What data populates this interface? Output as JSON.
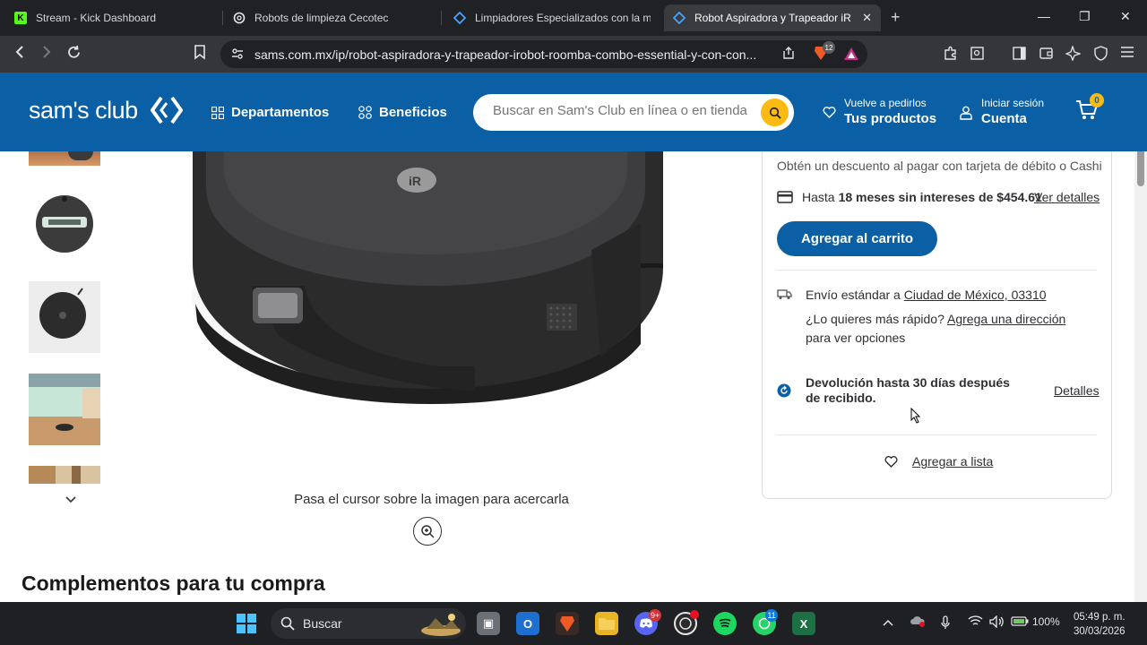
{
  "browser": {
    "tabs": [
      {
        "title": "Stream - Kick Dashboard",
        "icon": "kick-icon"
      },
      {
        "title": "Robots de limpieza Cecotec",
        "icon": "chatgpt-icon"
      },
      {
        "title": "Limpiadores Especializados con la me",
        "icon": "code-icon"
      },
      {
        "title": "Robot Aspiradora y Trapeador iR",
        "icon": "code-icon",
        "active": true
      }
    ],
    "url": "sams.com.mx/ip/robot-aspiradora-y-trapeador-irobot-roomba-combo-essential-y-con-con...",
    "brave_badge": "12"
  },
  "header": {
    "logo_text": "sam's club",
    "departments": "Departamentos",
    "benefits": "Beneficios",
    "search_placeholder": "Buscar en Sam's Club en línea o en tienda",
    "reorder_small": "Vuelve a pedirlos",
    "reorder_big": "Tus productos",
    "account_small": "Iniciar sesión",
    "account_big": "Cuenta",
    "cart_count": "0",
    "brand_color": "#0b5fa5",
    "accent_color": "#fdbb12"
  },
  "gallery": {
    "zoom_hint": "Pasa el cursor sobre la imagen para acercarla",
    "thumbnail_count": 5
  },
  "buybox": {
    "discount_text": "Obtén un descuento al pagar con tarjeta de débito o Cashi",
    "msi_prefix": "Hasta",
    "msi_bold": "18 meses sin intereses de $454.61",
    "msi_link": "Ver detalles",
    "add_to_cart": "Agregar al carrito",
    "shipping_prefix": "Envío estándar a",
    "shipping_location": "Ciudad de México, 03310",
    "faster_prefix": "¿Lo quieres más rápido?",
    "faster_link": "Agrega una dirección",
    "faster_suffix": "para ver opciones",
    "returns_text": "Devolución hasta 30 días después de recibido.",
    "returns_link": "Detalles",
    "add_to_list": "Agregar a lista"
  },
  "section_title": "Complementos para tu compra",
  "taskbar": {
    "search_label": "Buscar",
    "discord_badge": "9+",
    "whatsapp_badge": "11",
    "battery": "100%",
    "time": "05:49 p. m.",
    "date": "30/03/2026"
  }
}
